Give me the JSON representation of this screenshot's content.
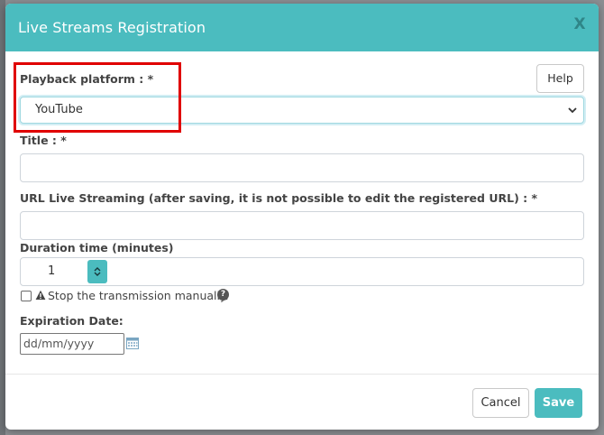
{
  "modal": {
    "title": "Live Streams Registration",
    "close_label": "X"
  },
  "help_button": "Help",
  "playback": {
    "label": "Playback platform : *",
    "selected": "YouTube"
  },
  "title_field": {
    "label": "Title : *",
    "value": ""
  },
  "url_field": {
    "label": "URL Live Streaming (after saving, it is not possible to edit the registered URL) : *",
    "value": ""
  },
  "duration": {
    "label": "Duration time (minutes)",
    "value": "1"
  },
  "stop_manual": {
    "label": "Stop the transmission manually.",
    "checked": false
  },
  "expiration": {
    "label": "Expiration Date:",
    "placeholder": "dd/mm/yyyy"
  },
  "footer": {
    "cancel_label": "Cancel",
    "save_label": "Save"
  },
  "colors": {
    "accent": "#4bbcbf",
    "highlight": "#e00000"
  },
  "icons": [
    "close-icon",
    "chevron-down-icon",
    "stepper-icon",
    "warning-icon",
    "question-icon",
    "calendar-icon"
  ]
}
